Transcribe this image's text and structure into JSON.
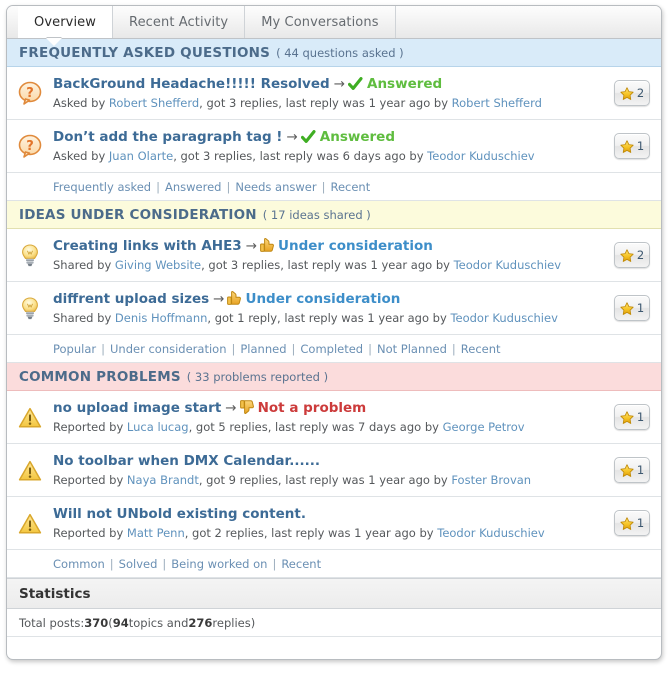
{
  "tabs": [
    {
      "label": "Overview",
      "active": true
    },
    {
      "label": "Recent Activity",
      "active": false
    },
    {
      "label": "My Conversations",
      "active": false
    }
  ],
  "sections": [
    {
      "id": "faq",
      "title": "FREQUENTLY ASKED QUESTIONS",
      "count_text": "( 44 questions asked )",
      "header_bg": "#d9ebf9",
      "icon": "question-bubble-icon",
      "items": [
        {
          "title": "BackGround Headache!!!!! Resolved",
          "arrow": "→",
          "status_icon": "check-icon",
          "status_label": "Answered",
          "status_color": "#5fbd3f",
          "meta_prefix": "Asked by ",
          "author": "Robert Shefferd",
          "meta_middle": ", got 3 replies, last reply was 1 year ago by ",
          "last_user": "Robert Shefferd",
          "votes": "2"
        },
        {
          "title": "Don’t add the paragraph tag !",
          "arrow": "→",
          "status_icon": "check-icon",
          "status_label": "Answered",
          "status_color": "#5fbd3f",
          "meta_prefix": "Asked by ",
          "author": "Juan Olarte",
          "meta_middle": ", got 3 replies, last reply was 6 days ago by ",
          "last_user": "Teodor Kuduschiev",
          "votes": "1"
        }
      ],
      "filters": [
        "Frequently asked",
        "Answered",
        "Needs answer",
        "Recent"
      ]
    },
    {
      "id": "ideas",
      "title": "IDEAS UNDER CONSIDERATION",
      "count_text": "( 17 ideas shared )",
      "header_bg": "#fcfbdc",
      "icon": "lightbulb-icon",
      "items": [
        {
          "title": "Creating links with AHE3",
          "arrow": "→",
          "status_icon": "thumbs-up-icon",
          "status_label": "Under consideration",
          "status_color": "#3d8ec9",
          "meta_prefix": "Shared by ",
          "author": "Giving Website",
          "meta_middle": ", got 3 replies, last reply was 1 year ago by ",
          "last_user": "Teodor Kuduschiev",
          "votes": "2"
        },
        {
          "title": "diffrent upload sizes",
          "arrow": "→",
          "status_icon": "thumbs-up-icon",
          "status_label": "Under consideration",
          "status_color": "#3d8ec9",
          "meta_prefix": "Shared by ",
          "author": "Denis Hoffmann",
          "meta_middle": ", got 1 reply, last reply was 1 year ago by ",
          "last_user": "Teodor Kuduschiev",
          "votes": "1"
        }
      ],
      "filters": [
        "Popular",
        "Under consideration",
        "Planned",
        "Completed",
        "Not Planned",
        "Recent"
      ]
    },
    {
      "id": "problems",
      "title": "COMMON PROBLEMS",
      "count_text": "( 33 problems reported )",
      "header_bg": "#fbdcdc",
      "icon": "warning-triangle-icon",
      "items": [
        {
          "title": "no upload image start",
          "arrow": "→",
          "status_icon": "thumbs-down-icon",
          "status_label": "Not a problem",
          "status_color": "#cc3b3b",
          "meta_prefix": "Reported by ",
          "author": "Luca lucag",
          "meta_middle": ", got 5 replies, last reply was 7 days ago by ",
          "last_user": "George Petrov",
          "votes": "1"
        },
        {
          "title": "No toolbar when DMX Calendar......",
          "arrow": "",
          "status_icon": "",
          "status_label": "",
          "status_color": "",
          "meta_prefix": "Reported by ",
          "author": "Naya Brandt",
          "meta_middle": ", got 9 replies, last reply was 1 year ago by ",
          "last_user": "Foster Brovan",
          "votes": "1"
        },
        {
          "title": "Will not UNbold existing content.",
          "arrow": "",
          "status_icon": "",
          "status_label": "",
          "status_color": "",
          "meta_prefix": "Reported by ",
          "author": "Matt Penn",
          "meta_middle": ", got 2 replies, last reply was 1 year ago by ",
          "last_user": "Teodor Kuduschiev",
          "votes": "1"
        }
      ],
      "filters": [
        "Common",
        "Solved",
        "Being worked on",
        "Recent"
      ]
    }
  ],
  "statistics": {
    "heading": "Statistics",
    "label": "Total posts: ",
    "total_posts": "370",
    "mid_open": " (",
    "topics": "94",
    "topics_label": " topics and ",
    "replies": "276",
    "replies_label": " replies)"
  },
  "icons": {
    "star": "star-icon",
    "badge_star": "star-icon"
  }
}
